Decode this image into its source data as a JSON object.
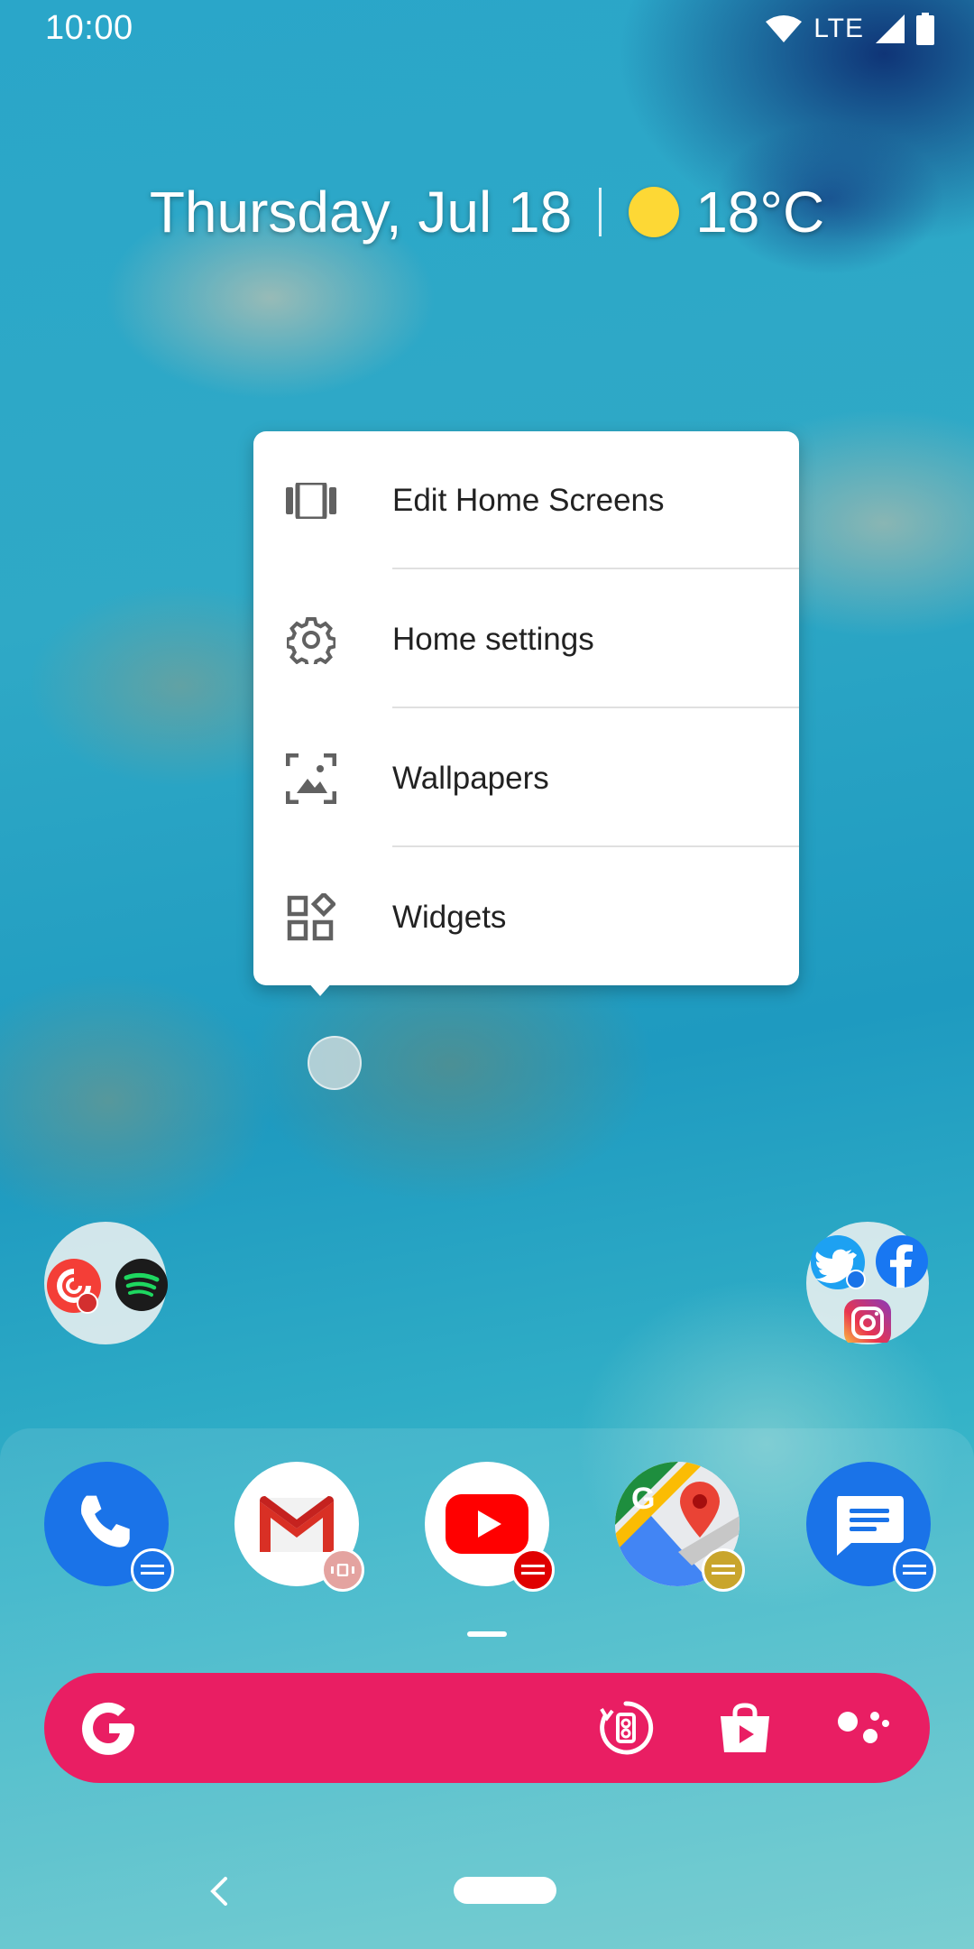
{
  "status_bar": {
    "time": "10:00",
    "network": "LTE",
    "icons": [
      "wifi-icon",
      "signal-icon",
      "battery-icon"
    ]
  },
  "glance": {
    "date": "Thursday, Jul 18",
    "weather_icon": "sun-icon",
    "temperature": "18°C"
  },
  "menu": {
    "items": [
      {
        "label": "Edit Home Screens",
        "icon": "edit-home-screens-icon"
      },
      {
        "label": "Home settings",
        "icon": "gear-icon"
      },
      {
        "label": "Wallpapers",
        "icon": "wallpaper-icon"
      },
      {
        "label": "Widgets",
        "icon": "widgets-icon"
      }
    ]
  },
  "folders": {
    "left": {
      "apps": [
        "pocket-casts-icon",
        "spotify-icon"
      ]
    },
    "right": {
      "apps": [
        "twitter-icon",
        "facebook-icon",
        "instagram-icon"
      ]
    }
  },
  "dock": {
    "apps": [
      {
        "name": "Phone",
        "icon": "phone-icon"
      },
      {
        "name": "Gmail",
        "icon": "gmail-icon"
      },
      {
        "name": "YouTube",
        "icon": "youtube-icon"
      },
      {
        "name": "Maps",
        "icon": "maps-icon"
      },
      {
        "name": "Messages",
        "icon": "messages-icon"
      }
    ]
  },
  "search_bar": {
    "color": "#e91e63",
    "icons": [
      "google-g-icon",
      "lens-icon",
      "play-store-icon",
      "assistant-icon"
    ]
  },
  "colors": {
    "phone": "#1a73e8",
    "messages": "#1a73e8",
    "youtube": "#ff0000",
    "gmail_red": "#d93025",
    "sun": "#fdd835"
  }
}
